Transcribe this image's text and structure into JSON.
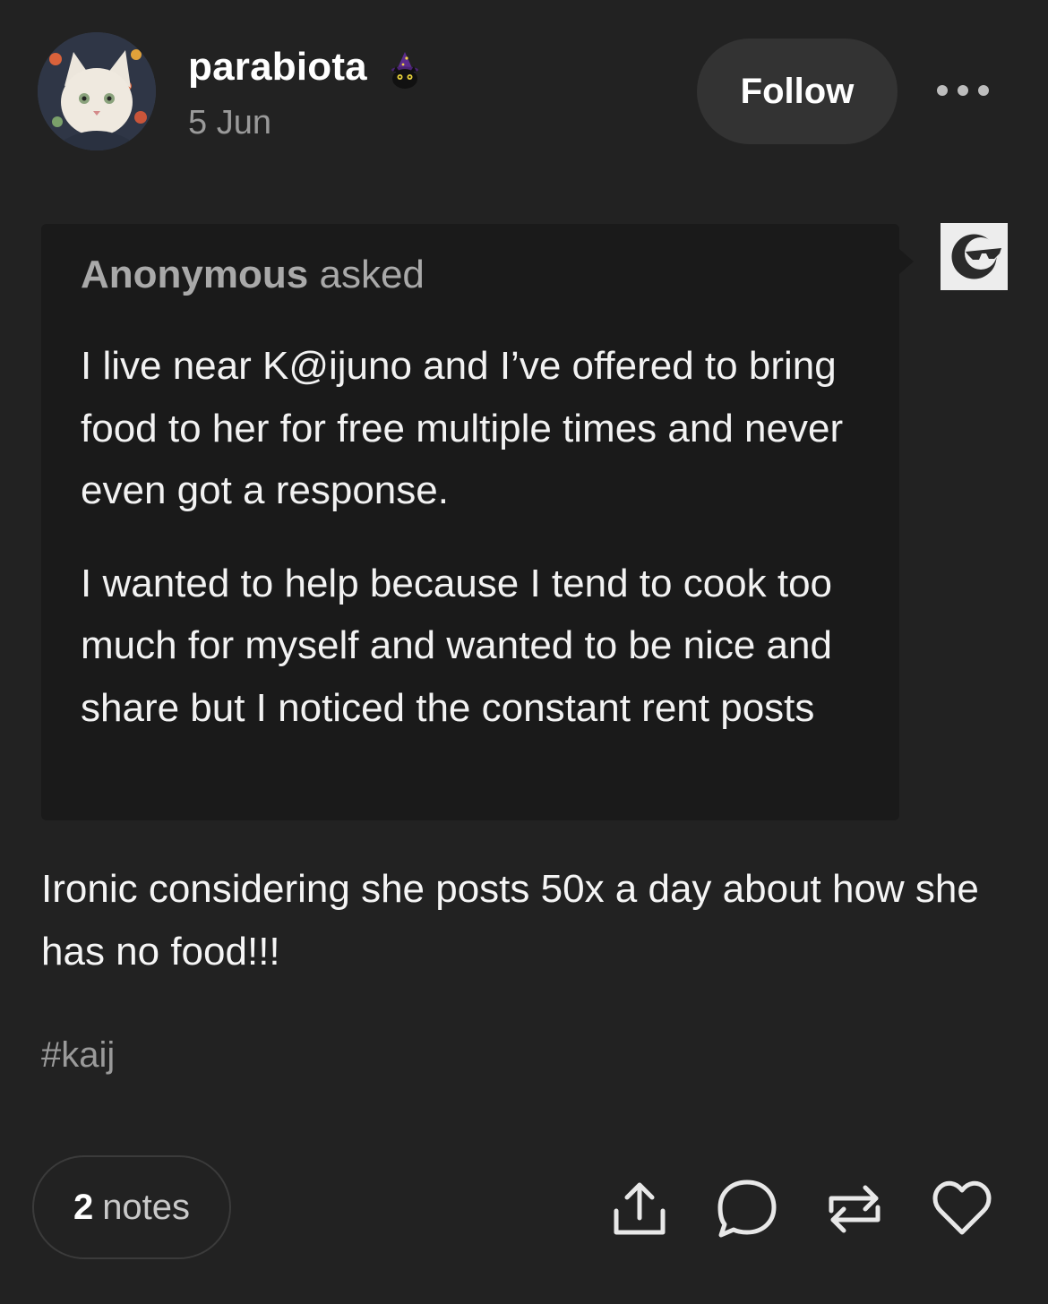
{
  "post": {
    "username": "parabiota",
    "date": "5 Jun",
    "follow_label": "Follow",
    "asker_name": "Anonymous",
    "asker_suffix": "asked",
    "question_paragraphs": [
      "I live near K@ijuno and I’ve offered to bring food to her for free multiple times and never even got a response.",
      "I wanted to help because I tend to cook too much for myself and wanted to be nice and share but I noticed the constant rent posts"
    ],
    "answer_text": "Ironic considering she posts 50x a day about how she has no food!!!",
    "tag": "#kaij"
  },
  "footer": {
    "notes_count": "2",
    "notes_label": "notes"
  },
  "icons": {
    "avatar": "cat-avatar",
    "badge": "wizard-cat-badge-icon",
    "more": "more-dots-icon",
    "anon": "anonymous-sunglasses-icon",
    "share": "share-icon",
    "reply": "reply-icon",
    "reblog": "reblog-icon",
    "like": "heart-icon"
  },
  "colors": {
    "background": "#222222",
    "ask_background": "#1a1a1a",
    "follow_button": "#333333",
    "muted_text": "#9a9a9a"
  }
}
